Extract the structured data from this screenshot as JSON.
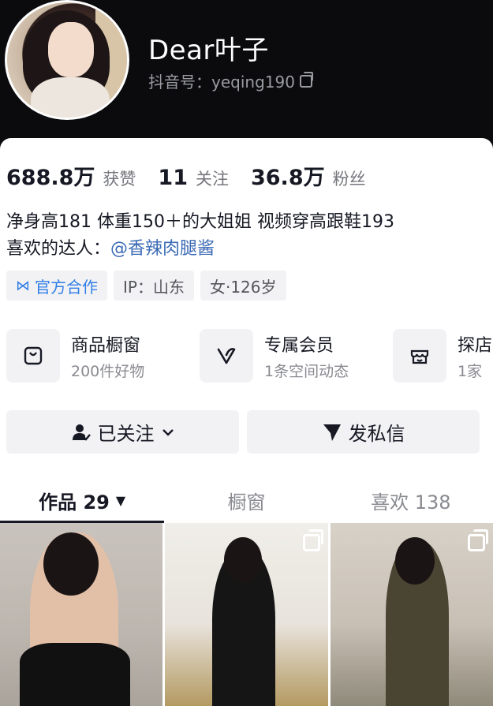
{
  "profile": {
    "nickname": "Dear叶子",
    "douyin_id": "抖音号：yeqing190"
  },
  "stats": [
    {
      "value": "688.8万",
      "label": "获赞"
    },
    {
      "value": "11",
      "label": "关注"
    },
    {
      "value": "36.8万",
      "label": "粉丝"
    }
  ],
  "bio": {
    "line1": "净身高181 体重150＋的大姐姐 视频穿高跟鞋193",
    "line2_prefix": "喜欢的达人：",
    "mention": "@香辣肉腿酱"
  },
  "tags": {
    "official": "官方合作",
    "ip": "IP：山东",
    "gender_age": "女·126岁"
  },
  "services": [
    {
      "title": "商品橱窗",
      "sub": "200件好物",
      "icon": "shopping-bag-icon"
    },
    {
      "title": "专属会员",
      "sub": "1条空间动态",
      "icon": "vip-v-icon"
    },
    {
      "title": "探店",
      "sub": "1家",
      "icon": "store-icon"
    }
  ],
  "actions": {
    "follow": "已关注",
    "message": "发私信"
  },
  "tabs": [
    {
      "label": "作品 29"
    },
    {
      "label": "橱窗"
    },
    {
      "label": "喜欢 138"
    }
  ],
  "colors": {
    "header_bg": "#0b0b0d",
    "mention": "#3b6ab5",
    "official": "#2f7ee8"
  }
}
